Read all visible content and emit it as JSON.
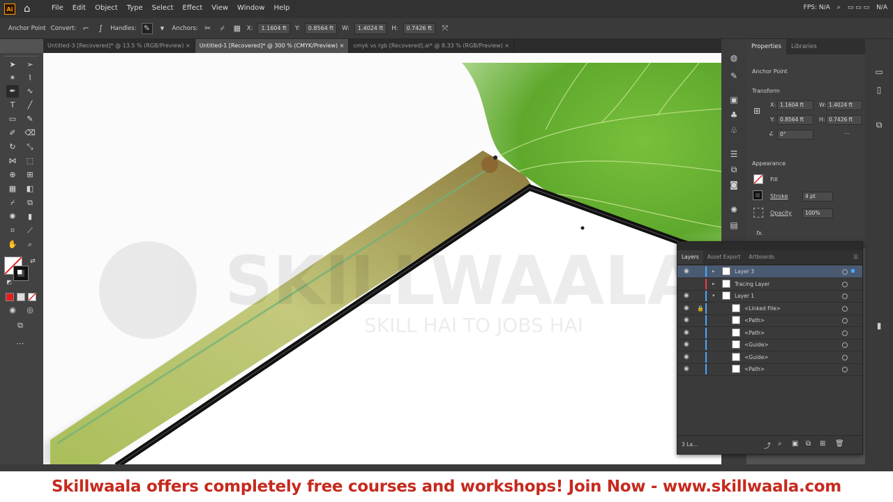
{
  "app": {
    "logo": "Ai",
    "menu": [
      "File",
      "Edit",
      "Object",
      "Type",
      "Select",
      "Effect",
      "View",
      "Window",
      "Help"
    ],
    "right_text": [
      "FPS: N/A",
      "N/A"
    ]
  },
  "control_bar": {
    "mode": "Anchor Point",
    "convert_label": "Convert:",
    "handles_label": "Handles:",
    "anchors_label": "Anchors:",
    "x_label": "X:",
    "x_value": "1.1604 ft",
    "y_label": "Y:",
    "y_value": "0.8564 ft",
    "w_label": "W:",
    "w_value": "1.4024 ft",
    "h_label": "H:",
    "h_value": "0.7426 ft"
  },
  "tabs": [
    {
      "label": "Untitled-3 [Recovered]* @ 13.5 % (RGB/Preview)",
      "active": false
    },
    {
      "label": "Untitled-1 [Recovered]* @ 300 % (CMYK/Preview)",
      "active": true
    },
    {
      "label": "cmyk vs rgb [Recovered].ai* @ 8.33 % (RGB/Preview)",
      "active": false
    }
  ],
  "properties": {
    "tabs": [
      "Properties",
      "Libraries"
    ],
    "selection": "Anchor Point",
    "transform_title": "Transform",
    "x_label": "X:",
    "x_value": "1.1604 ft",
    "y_label": "Y:",
    "y_value": "0.8564 ft",
    "w_label": "W:",
    "w_value": "1.4024 ft",
    "h_label": "H:",
    "h_value": "0.7426 ft",
    "angle_value": "0°",
    "appearance_title": "Appearance",
    "fill_label": "Fill",
    "stroke_label": "Stroke",
    "stroke_value": "4 pt",
    "opacity_label": "Opacity",
    "opacity_value": "100%",
    "fx_label": "fx."
  },
  "layers": {
    "tabs": [
      "Layers",
      "Asset Export",
      "Artboards"
    ],
    "rows": [
      {
        "name": "Layer 3",
        "indent": 0,
        "color": "#4aa7ff",
        "expanded": false,
        "active": true,
        "eye": true
      },
      {
        "name": "Tracing Layer",
        "indent": 0,
        "color": "#ff3a3a",
        "expanded": false,
        "active": false,
        "eye": false
      },
      {
        "name": "Layer 1",
        "indent": 0,
        "color": "#4aa7ff",
        "expanded": true,
        "active": false,
        "eye": true
      },
      {
        "name": "<Linked File>",
        "indent": 1,
        "color": "#4aa7ff",
        "active": false,
        "eye": true
      },
      {
        "name": "<Path>",
        "indent": 1,
        "color": "#4aa7ff",
        "active": false,
        "eye": true
      },
      {
        "name": "<Path>",
        "indent": 1,
        "color": "#4aa7ff",
        "active": false,
        "eye": true
      },
      {
        "name": "<Guide>",
        "indent": 1,
        "color": "#4aa7ff",
        "active": false,
        "eye": true
      },
      {
        "name": "<Guide>",
        "indent": 1,
        "color": "#4aa7ff",
        "active": false,
        "eye": true
      },
      {
        "name": "<Path>",
        "indent": 1,
        "color": "#4aa7ff",
        "active": false,
        "eye": true
      }
    ],
    "footer_count": "3 La..."
  },
  "watermark": {
    "brand": "SKILLWAALA",
    "tagline": "SKILL HAI TO JOBS HAI"
  },
  "banner": "Skillwaala offers completely free courses and workshops! Join Now  - www.skillwaala.com",
  "colors": {
    "banner_text": "#c62a1e",
    "layer_blue": "#4aa7ff",
    "layer_red": "#ff3a3a"
  }
}
